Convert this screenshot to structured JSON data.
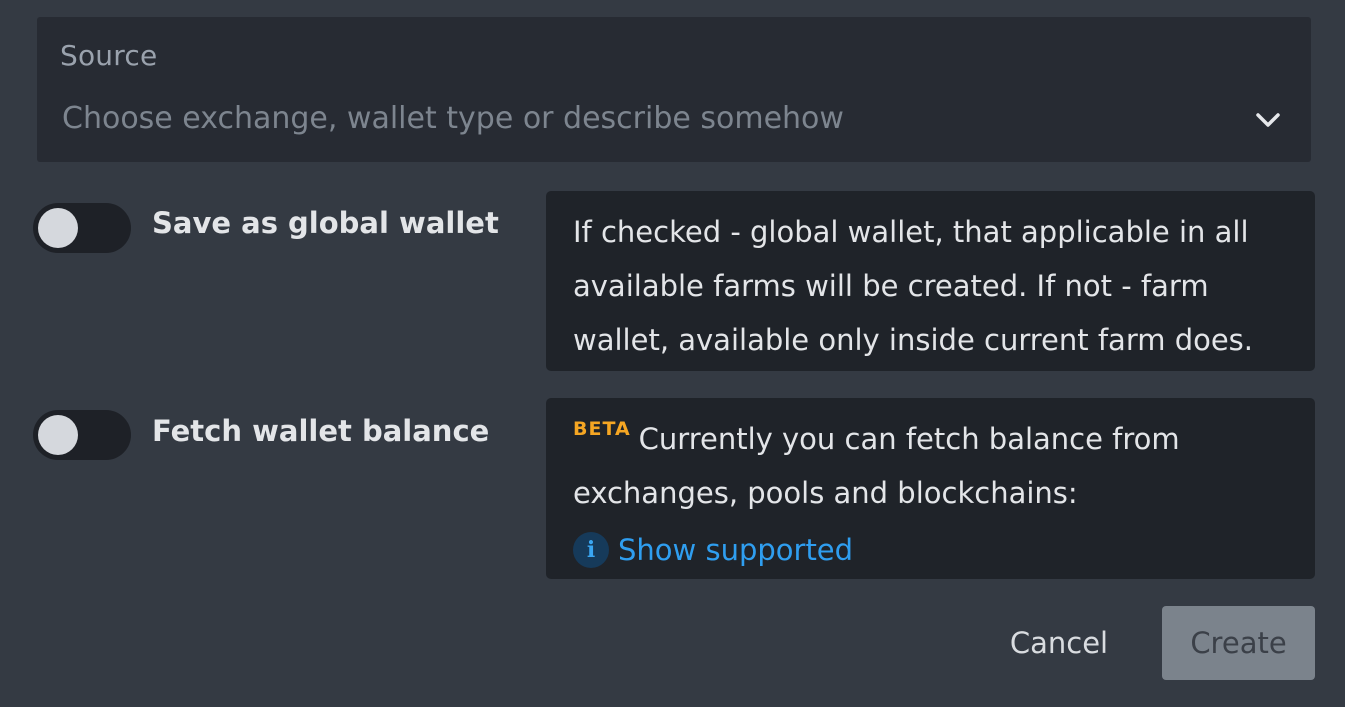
{
  "source": {
    "label": "Source",
    "placeholder": "Choose exchange, wallet type or describe somehow",
    "icon": "chevron-down-icon"
  },
  "global_wallet": {
    "label": "Save as global wallet",
    "checked": false,
    "info": "If checked - global wallet, that applicable in all available farms will be created. If not - farm wallet, available only inside current farm does."
  },
  "fetch_balance": {
    "label": "Fetch wallet balance",
    "checked": false,
    "badge": "BETA",
    "badge_color": "#f5a623",
    "info": "Currently you can fetch balance from exchanges, pools and blockchains:",
    "link_icon": "i",
    "link_label": "Show supported",
    "link_color": "#2f9ef0"
  },
  "actions": {
    "cancel_label": "Cancel",
    "create_label": "Create"
  }
}
